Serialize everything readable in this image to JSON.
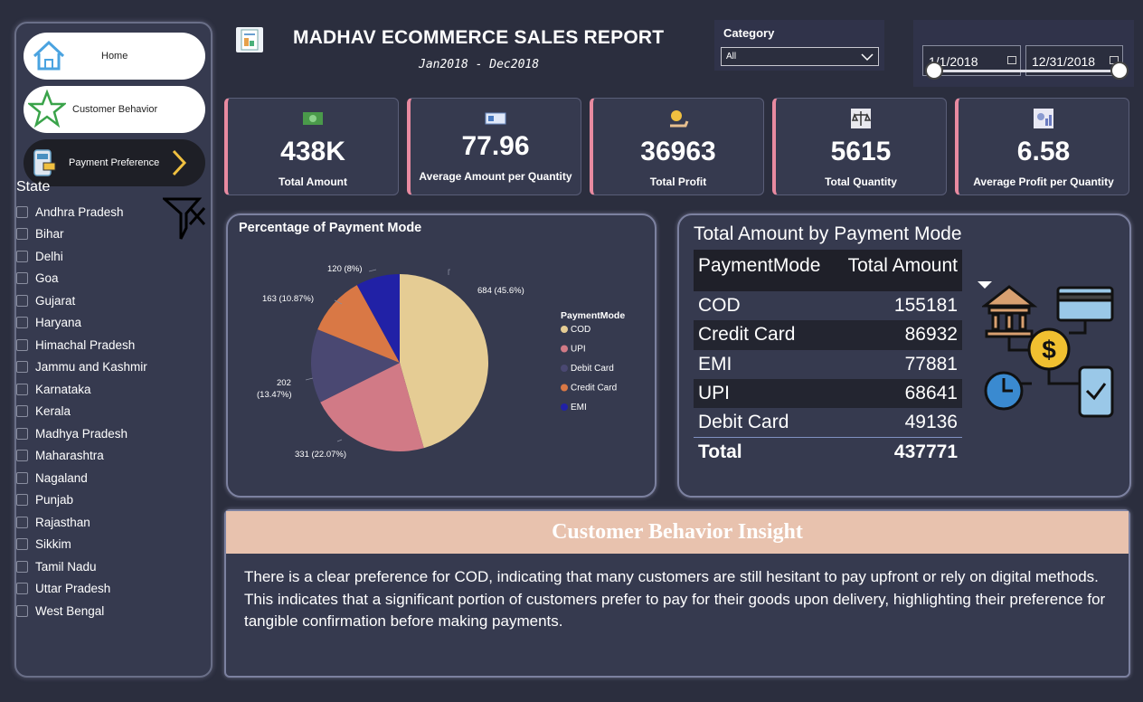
{
  "header": {
    "title": "MADHAV ECOMMERCE SALES REPORT",
    "subtitle": "Jan2018 - Dec2018"
  },
  "nav": {
    "home_label": "Home",
    "customer_behavior_label": "Customer Behavior",
    "payment_preference_label": "Payment Preference"
  },
  "filters": {
    "category_label": "Category",
    "category_value": "All",
    "date_start": "1/1/2018",
    "date_end": "12/31/2018",
    "state_label": "State",
    "states": [
      "Andhra Pradesh",
      "Bihar",
      "Delhi",
      "Goa",
      "Gujarat",
      "Haryana",
      "Himachal Pradesh",
      "Jammu and Kashmir",
      "Karnataka",
      "Kerala",
      "Madhya Pradesh",
      "Maharashtra",
      "Nagaland",
      "Punjab",
      "Rajasthan",
      "Sikkim",
      "Tamil Nadu",
      "Uttar Pradesh",
      "West Bengal"
    ]
  },
  "kpis": [
    {
      "value": "438K",
      "label": "Total Amount"
    },
    {
      "value": "77.96",
      "label": "Average Amount per Quantity"
    },
    {
      "value": "36963",
      "label": "Total Profit"
    },
    {
      "value": "5615",
      "label": "Total Quantity"
    },
    {
      "value": "6.58",
      "label": "Average Profit per Quantity"
    }
  ],
  "pie": {
    "title": "Percentage of Payment Mode",
    "legend_title": "PaymentMode",
    "labels": {
      "cod": "684 (45.6%)",
      "upi": "331 (22.07%)",
      "debit_line1": "202",
      "debit_line2": "(13.47%)",
      "credit": "163 (10.87%)",
      "emi": "120 (8%)"
    }
  },
  "chart_data": {
    "type": "pie",
    "title": "Percentage of Payment Mode",
    "legend_title": "PaymentMode",
    "series": [
      {
        "name": "COD",
        "value": 684,
        "percent": 45.6,
        "color": "#e5cc94"
      },
      {
        "name": "UPI",
        "value": 331,
        "percent": 22.07,
        "color": "#d17a86"
      },
      {
        "name": "Debit Card",
        "value": 202,
        "percent": 13.47,
        "color": "#4a4872"
      },
      {
        "name": "Credit Card",
        "value": 163,
        "percent": 10.87,
        "color": "#d97845"
      },
      {
        "name": "EMI",
        "value": 120,
        "percent": 8,
        "color": "#2121a6"
      }
    ]
  },
  "table": {
    "title": "Total Amount by Payment Mode",
    "col1": "PaymentMode",
    "col2": "Total Amount",
    "rows": [
      {
        "mode": "COD",
        "amount": "155181"
      },
      {
        "mode": "Credit Card",
        "amount": "86932"
      },
      {
        "mode": "EMI",
        "amount": "77881"
      },
      {
        "mode": "UPI",
        "amount": "68641"
      },
      {
        "mode": "Debit Card",
        "amount": "49136"
      }
    ],
    "total_label": "Total",
    "total_value": "437771"
  },
  "insight": {
    "heading": "Customer Behavior Insight",
    "line1": "There is a clear preference for COD, indicating that many customers are still hesitant to pay upfront or rely on digital methods.",
    "line2": "This indicates that a significant portion of customers prefer to pay for their goods upon delivery, highlighting their preference for tangible confirmation before making payments."
  },
  "colors": {
    "background": "#2b2e3e",
    "panel": "#363a4f",
    "kpi_accent": "#e88aa0",
    "insight_header": "#e8c2ae"
  }
}
